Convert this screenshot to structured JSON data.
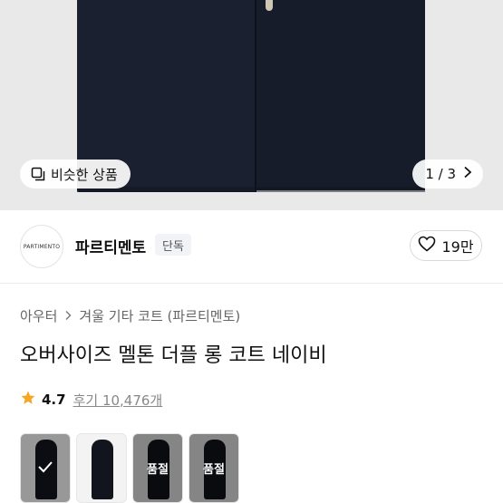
{
  "hero": {
    "similar_label": "비슷한 상품",
    "page_indicator": "1 / 3",
    "similar_icon": "similar-items-icon",
    "next_icon": "chevron-right-icon"
  },
  "brand": {
    "logo_text": "PARTIMENTO",
    "name": "파르티멘토",
    "badge": "단독",
    "like_count": "19만",
    "like_icon": "heart-icon"
  },
  "product": {
    "breadcrumb": [
      "아우터",
      "겨울 기타 코트 (파르티멘토)"
    ],
    "title": "오버사이즈 멜톤 더플 롱 코트 네이비",
    "rating": "4.7",
    "reviews": "후기 10,476개",
    "star_color": "#f5a623"
  },
  "options": [
    {
      "state": "selected",
      "label": ""
    },
    {
      "state": "available",
      "label": ""
    },
    {
      "state": "soldout",
      "label": "품절"
    },
    {
      "state": "soldout",
      "label": "품절"
    }
  ]
}
